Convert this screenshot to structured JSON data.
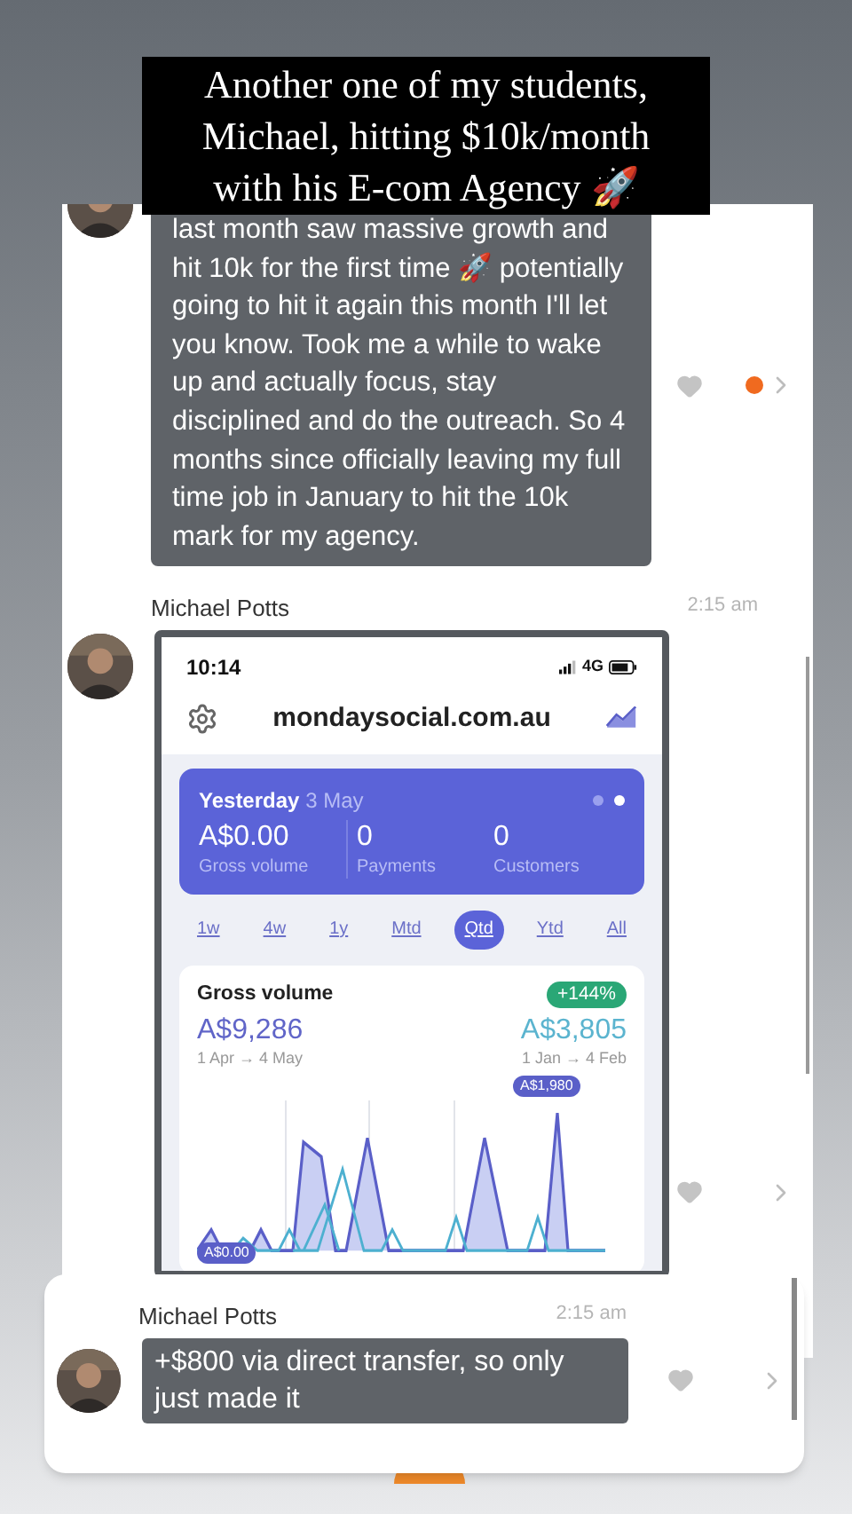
{
  "caption": "Another one of my students, Michael, hitting $10k/month with his E-com Agency 🚀",
  "chat": {
    "messages": [
      {
        "kind": "text",
        "text": "last month saw massive growth and hit 10k for the first time 🚀 potentially going to hit it again this month I'll let you know. Took me a while to wake up and actually focus, stay disciplined and do the outreach. So 4 months since officially leaving my full time job in January to hit the 10k mark for my agency.",
        "unread": true
      },
      {
        "kind": "screenshot",
        "sender": "Michael Potts",
        "time": "2:15 am",
        "unread": false,
        "screenshot": {
          "status_time": "10:14",
          "network": "4G",
          "site": "mondaysocial.com.au",
          "summary": {
            "day": "Yesterday",
            "date": "3 May",
            "stats": [
              {
                "value": "A$0.00",
                "label": "Gross volume"
              },
              {
                "value": "0",
                "label": "Payments"
              },
              {
                "value": "0",
                "label": "Customers"
              }
            ],
            "pages": [
              {
                "selected": false
              },
              {
                "selected": true
              }
            ]
          },
          "ranges": [
            {
              "label": "1w",
              "selected": false
            },
            {
              "label": "4w",
              "selected": false
            },
            {
              "label": "1y",
              "selected": false
            },
            {
              "label": "Mtd",
              "selected": false
            },
            {
              "label": "Qtd",
              "selected": true
            },
            {
              "label": "Ytd",
              "selected": false
            },
            {
              "label": "All",
              "selected": false
            }
          ],
          "volume": {
            "title": "Gross volume",
            "change": "+144%",
            "current": "A$9,286",
            "current_range": "1 Apr → 4 May",
            "previous": "A$3,805",
            "previous_range": "1 Jan → 4 Feb",
            "peak_label": "A$1,980",
            "low_label": "A$0.00"
          }
        }
      }
    ]
  },
  "overlay_message": {
    "kind": "text",
    "sender": "Michael Potts",
    "time": "2:15 am",
    "text": "+$800 via direct transfer, so only just made it"
  }
}
